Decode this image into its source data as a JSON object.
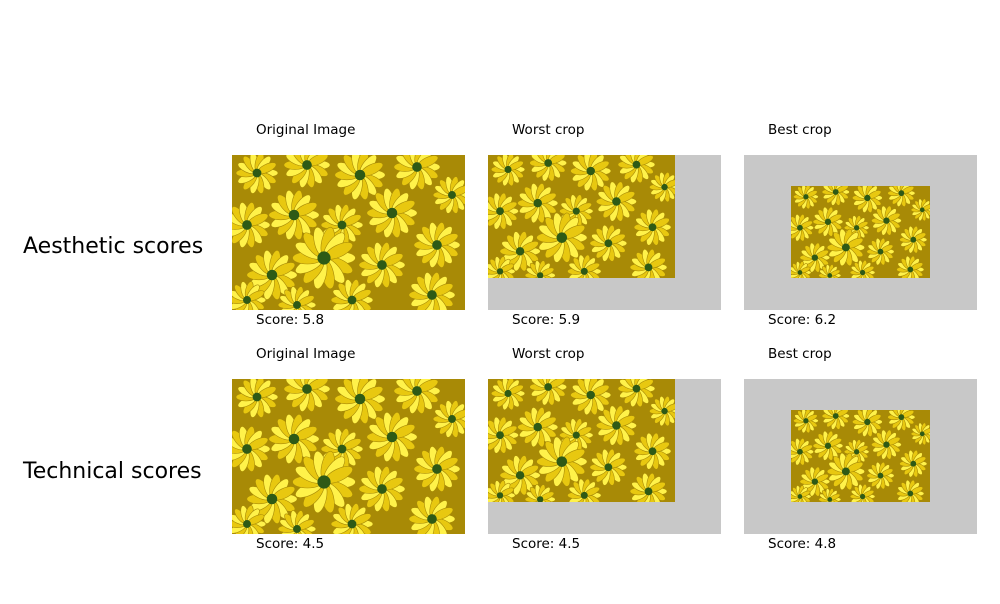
{
  "rows": [
    {
      "title": "Aesthetic scores",
      "panels": [
        {
          "caption": "Original Image",
          "score": "Score: 5.8"
        },
        {
          "caption": "Worst crop",
          "score": "Score: 5.9"
        },
        {
          "caption": "Best crop",
          "score": "Score: 6.2"
        }
      ]
    },
    {
      "title": "Technical scores",
      "panels": [
        {
          "caption": "Original Image",
          "score": "Score: 4.5"
        },
        {
          "caption": "Worst crop",
          "score": "Score: 4.5"
        },
        {
          "caption": "Best crop",
          "score": "Score: 4.8"
        }
      ]
    }
  ],
  "colors": {
    "crop_background": "#c8c8c8",
    "petal_light": "#fff24a",
    "petal_mid": "#e8c810",
    "petal_dark": "#a88a06",
    "flower_center": "#2e5a16"
  },
  "image_subject": "yellow-chrysanthemum-flowers"
}
